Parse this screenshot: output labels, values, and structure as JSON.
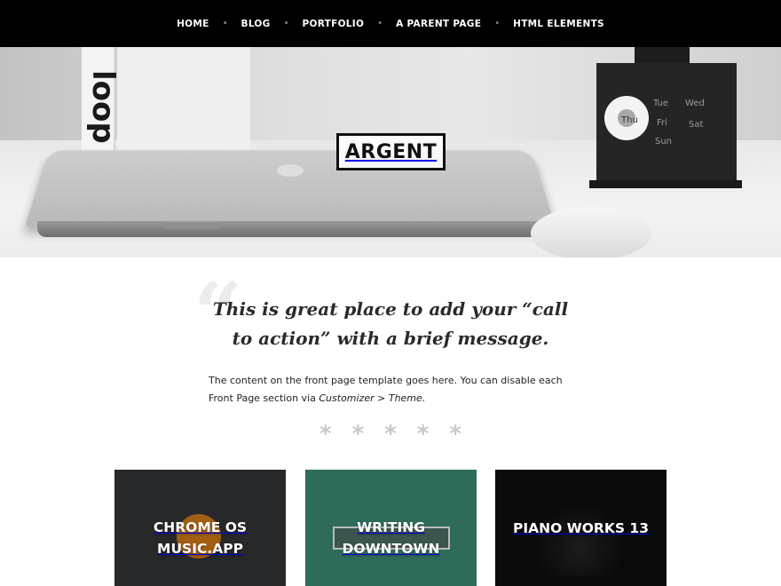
{
  "nav": {
    "items": [
      {
        "label": "HOME"
      },
      {
        "label": "BLOG"
      },
      {
        "label": "PORTFOLIO"
      },
      {
        "label": "A PARENT PAGE"
      },
      {
        "label": "HTML ELEMENTS"
      }
    ],
    "separator": "•"
  },
  "hero": {
    "logo": "ARGENT",
    "book_text": "loop",
    "calendar_days": [
      "Tue",
      "Wed",
      "Thu",
      "Fri",
      "Sat",
      "Sun"
    ]
  },
  "content": {
    "cta": "This is great place to add your “call to action” with a brief message.",
    "intro_text": "The content on the front page template goes here. You can disable each Front Page section via ",
    "intro_emphasis": "Customizer > Theme.",
    "stars": [
      "*",
      "*",
      "*",
      "*",
      "*"
    ]
  },
  "portfolio": {
    "items": [
      {
        "title_line1": "CHROME OS",
        "title_line2": "MUSIC.APP",
        "color": "#27282a"
      },
      {
        "title_line1": "WRITING",
        "title_line2": "DOWNTOWN",
        "color": "#2f6b5a"
      },
      {
        "title_line1": "PIANO WORKS 13",
        "title_line2": "",
        "color": "#0a0a0a"
      }
    ]
  }
}
